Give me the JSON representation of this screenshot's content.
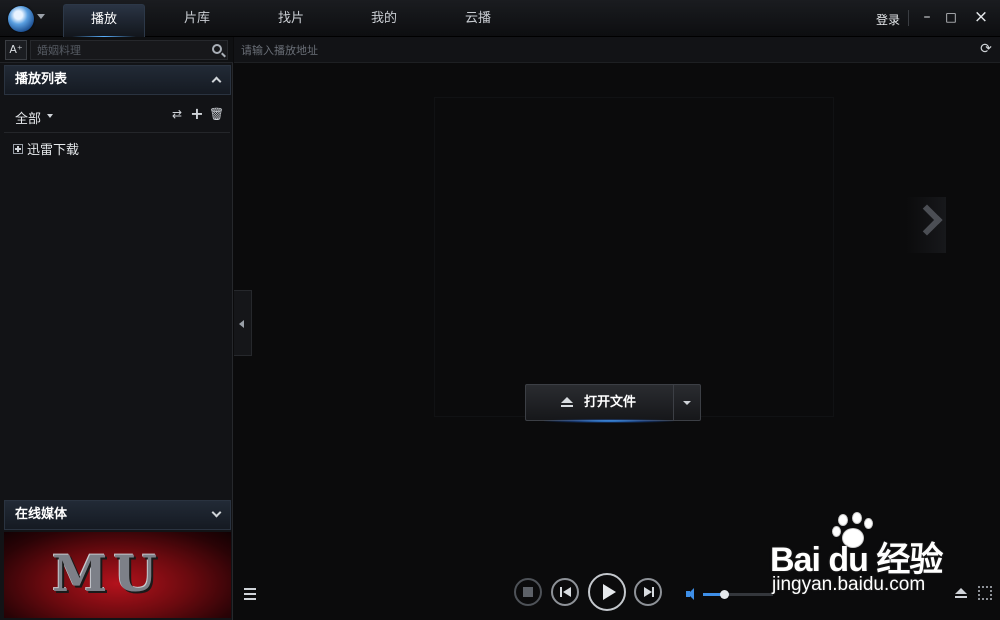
{
  "app": {
    "nav_tabs": [
      {
        "label": "播放",
        "active": true
      },
      {
        "label": "片库",
        "active": false
      },
      {
        "label": "找片",
        "active": false
      },
      {
        "label": "我的",
        "active": false
      },
      {
        "label": "云播",
        "active": false
      }
    ],
    "login_label": "登录",
    "window_controls": {
      "minimize": "–",
      "maximize": "□",
      "close": "×"
    }
  },
  "sidebar": {
    "font_button": "A⁺",
    "search_placeholder": "婚姻料理",
    "playlist_header": "播放列表",
    "filter_label": "全部",
    "tree_items": [
      {
        "label": "迅雷下载"
      }
    ],
    "online_media_header": "在线媒体",
    "banner_text": "MU"
  },
  "player": {
    "url_placeholder": "请输入播放地址",
    "open_file_label": "打开文件",
    "volume_level": 0.3
  },
  "watermark": {
    "brand": "Bai du 经验",
    "url": "jingyan.baidu.com"
  },
  "colors": {
    "accent": "#3e8fe8",
    "background": "#0b0b0c",
    "panel": "#121316"
  },
  "icons": [
    "xunlei-logo-icon",
    "search-icon",
    "refresh-icon",
    "eject-icon",
    "play-icon",
    "stop-icon",
    "previous-icon",
    "next-icon",
    "volume-icon",
    "fullscreen-icon",
    "playlist-icon"
  ]
}
